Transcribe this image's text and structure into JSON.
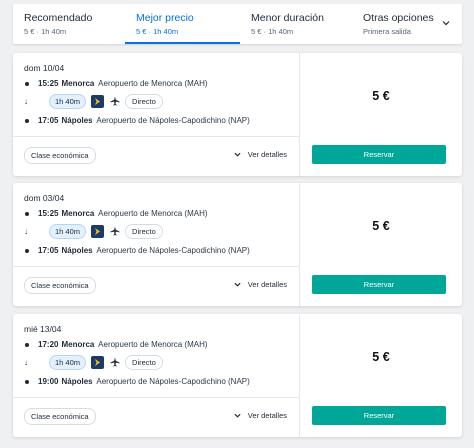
{
  "sort_tabs": [
    {
      "label": "Recomendado",
      "sub": "5 € · 1h 40m",
      "active": false
    },
    {
      "label": "Mejor precio",
      "sub": "5 € · 1h 40m",
      "active": true
    },
    {
      "label": "Menor duración",
      "sub": "5 € · 1h 40m",
      "active": false
    },
    {
      "label": "Otras opciones",
      "sub": "Primera salida",
      "active": false
    }
  ],
  "results": [
    {
      "date": "dom 10/04",
      "dep_time": "15:25",
      "dep_city": "Menorca",
      "dep_airport": "Aeropuerto de Menorca (MAH)",
      "duration": "1h 40m",
      "stops": "Directo",
      "arr_time": "17:05",
      "arr_city": "Nápoles",
      "arr_airport": "Aeropuerto de Nápoles-Capodichino (NAP)",
      "cabin": "Clase económica",
      "details": "Ver detalles",
      "price": "5 €",
      "cta": "Reservar"
    },
    {
      "date": "dom 03/04",
      "dep_time": "15:25",
      "dep_city": "Menorca",
      "dep_airport": "Aeropuerto de Menorca (MAH)",
      "duration": "1h 40m",
      "stops": "Directo",
      "arr_time": "17:05",
      "arr_city": "Nápoles",
      "arr_airport": "Aeropuerto de Nápoles-Capodichino (NAP)",
      "cabin": "Clase económica",
      "details": "Ver detalles",
      "price": "5 €",
      "cta": "Reservar"
    },
    {
      "date": "mié 13/04",
      "dep_time": "17:20",
      "dep_city": "Menorca",
      "dep_airport": "Aeropuerto de Menorca (MAH)",
      "duration": "1h 40m",
      "stops": "Directo",
      "arr_time": "19:00",
      "arr_city": "Nápoles",
      "arr_airport": "Aeropuerto de Nápoles-Capodichino (NAP)",
      "cabin": "Clase económica",
      "details": "Ver detalles",
      "price": "5 €",
      "cta": "Reservar"
    }
  ],
  "icons": {
    "expand": "chevron-down-icon",
    "airline": "airline-logo-icon",
    "plane": "plane-icon",
    "details": "chevron-down-icon",
    "arrow": "arrow-down-icon"
  },
  "colors": {
    "accent": "#0770e3",
    "cta": "#00a698",
    "duration_pill": "#e3f0fd",
    "airline_logo": "#1c3a6b"
  }
}
